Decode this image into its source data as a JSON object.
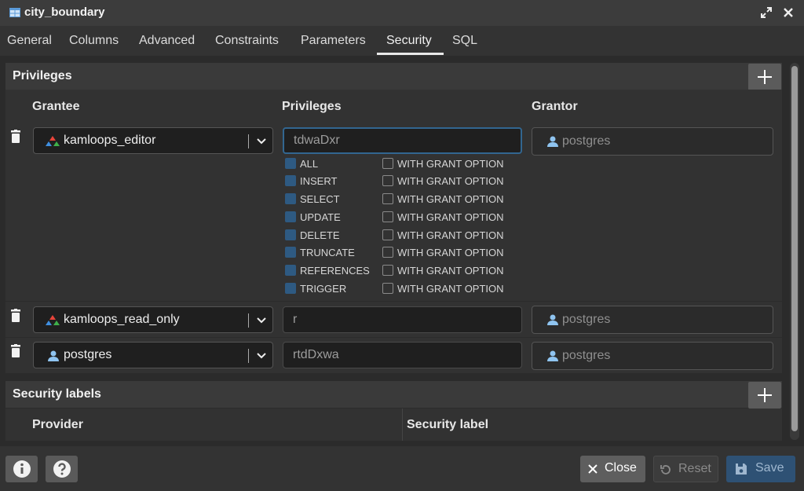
{
  "window": {
    "title": "city_boundary"
  },
  "tabs": [
    "General",
    "Columns",
    "Advanced",
    "Constraints",
    "Parameters",
    "Security",
    "SQL"
  ],
  "active_tab": "Security",
  "privileges_panel": {
    "title": "Privileges",
    "columns": {
      "grantee": "Grantee",
      "privileges": "Privileges",
      "grantor": "Grantor"
    },
    "rows": [
      {
        "grantee": "kamloops_editor",
        "grantee_icon": "group-role-icon",
        "privileges": "tdwaDxr",
        "grantor": "postgres"
      },
      {
        "grantee": "kamloops_read_only",
        "grantee_icon": "group-role-icon",
        "privileges": "r",
        "grantor": "postgres"
      },
      {
        "grantee": "postgres",
        "grantee_icon": "user-icon",
        "privileges": "rtdDxwa",
        "grantor": "postgres"
      }
    ],
    "privilege_options": [
      {
        "name": "ALL",
        "checked": true
      },
      {
        "name": "INSERT",
        "checked": true
      },
      {
        "name": "SELECT",
        "checked": true
      },
      {
        "name": "UPDATE",
        "checked": true
      },
      {
        "name": "DELETE",
        "checked": true
      },
      {
        "name": "TRUNCATE",
        "checked": true
      },
      {
        "name": "REFERENCES",
        "checked": true
      },
      {
        "name": "TRIGGER",
        "checked": true
      }
    ],
    "grant_option_label": "WITH GRANT OPTION"
  },
  "security_labels_panel": {
    "title": "Security labels",
    "columns": {
      "provider": "Provider",
      "label": "Security label"
    }
  },
  "footer": {
    "close": "Close",
    "reset": "Reset",
    "save": "Save"
  },
  "colors": {
    "accent": "#326690",
    "checked": "#2e5a82",
    "save_bg": "#2e5174"
  }
}
